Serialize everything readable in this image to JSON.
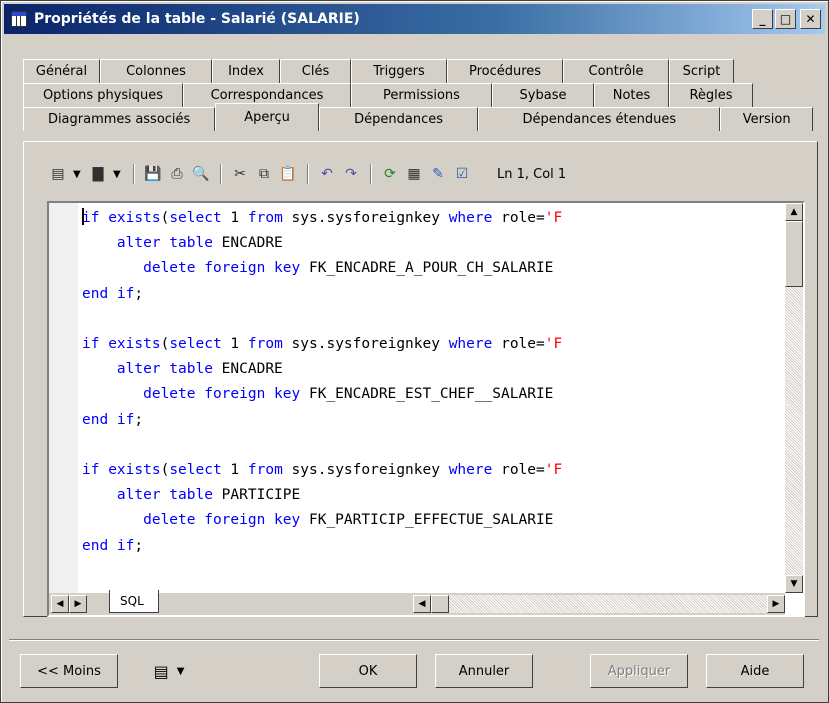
{
  "window": {
    "title": "Propriétés de la table - Salarié (SALARIE)",
    "controls": {
      "minimize": "_",
      "maximize": "□",
      "close": "✕"
    }
  },
  "tabs": {
    "row1": [
      "Général",
      "Colonnes",
      "Index",
      "Clés",
      "Triggers",
      "Procédures",
      "Contrôle",
      "Script"
    ],
    "row2": [
      "Options physiques",
      "Correspondances",
      "Permissions",
      "Sybase",
      "Notes",
      "Règles"
    ],
    "row3": [
      "Diagrammes associés",
      "Aperçu",
      "Dépendances",
      "Dépendances étendues",
      "Version"
    ],
    "active": "Aperçu"
  },
  "toolbar": {
    "icons": [
      "script-menu-icon",
      "new-document-icon",
      "save-icon",
      "print-icon",
      "find-icon",
      "cut-icon",
      "copy-icon",
      "paste-icon",
      "undo-icon",
      "redo-icon",
      "refresh-icon",
      "format-icon",
      "edit-icon",
      "check-icon"
    ],
    "position": "Ln 1, Col 1"
  },
  "editor": {
    "lines": [
      [
        [
          "kw",
          "if exists"
        ],
        [
          "id",
          "("
        ],
        [
          "kw",
          "select"
        ],
        [
          "id",
          " 1 "
        ],
        [
          "kw",
          "from"
        ],
        [
          "id",
          " sys.sysforeignkey "
        ],
        [
          "kw",
          "where"
        ],
        [
          "id",
          " role="
        ],
        [
          "str",
          "'F"
        ]
      ],
      [
        [
          "kw",
          "    alter table"
        ],
        [
          "id",
          " ENCADRE"
        ]
      ],
      [
        [
          "kw",
          "       delete foreign key"
        ],
        [
          "id",
          " FK_ENCADRE_A_POUR_CH_SALARIE"
        ]
      ],
      [
        [
          "kw",
          "end if"
        ],
        [
          "id",
          ";"
        ]
      ],
      [
        [
          "id",
          ""
        ]
      ],
      [
        [
          "kw",
          "if exists"
        ],
        [
          "id",
          "("
        ],
        [
          "kw",
          "select"
        ],
        [
          "id",
          " 1 "
        ],
        [
          "kw",
          "from"
        ],
        [
          "id",
          " sys.sysforeignkey "
        ],
        [
          "kw",
          "where"
        ],
        [
          "id",
          " role="
        ],
        [
          "str",
          "'F"
        ]
      ],
      [
        [
          "kw",
          "    alter table"
        ],
        [
          "id",
          " ENCADRE"
        ]
      ],
      [
        [
          "kw",
          "       delete foreign key"
        ],
        [
          "id",
          " FK_ENCADRE_EST_CHEF__SALARIE"
        ]
      ],
      [
        [
          "kw",
          "end if"
        ],
        [
          "id",
          ";"
        ]
      ],
      [
        [
          "id",
          ""
        ]
      ],
      [
        [
          "kw",
          "if exists"
        ],
        [
          "id",
          "("
        ],
        [
          "kw",
          "select"
        ],
        [
          "id",
          " 1 "
        ],
        [
          "kw",
          "from"
        ],
        [
          "id",
          " sys.sysforeignkey "
        ],
        [
          "kw",
          "where"
        ],
        [
          "id",
          " role="
        ],
        [
          "str",
          "'F"
        ]
      ],
      [
        [
          "kw",
          "    alter table"
        ],
        [
          "id",
          " PARTICIPE"
        ]
      ],
      [
        [
          "kw",
          "       delete foreign key"
        ],
        [
          "id",
          " FK_PARTICIP_EFFECTUE_SALARIE"
        ]
      ],
      [
        [
          "kw",
          "end if"
        ],
        [
          "id",
          ";"
        ]
      ]
    ],
    "sheet_tab": "SQL"
  },
  "buttons": {
    "less": "<< Moins",
    "ok": "OK",
    "cancel": "Annuler",
    "apply": "Appliquer",
    "help": "Aide"
  },
  "colors": {
    "keyword": "#0000ff",
    "string": "#ff0000",
    "titlebar": "#0a246a"
  }
}
